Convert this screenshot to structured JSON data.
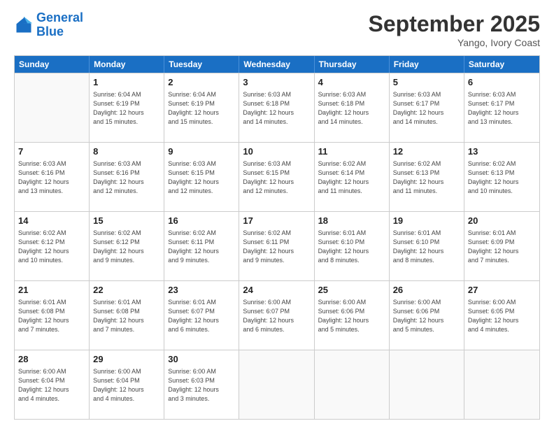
{
  "logo": {
    "line1": "General",
    "line2": "Blue"
  },
  "title": "September 2025",
  "subtitle": "Yango, Ivory Coast",
  "header_days": [
    "Sunday",
    "Monday",
    "Tuesday",
    "Wednesday",
    "Thursday",
    "Friday",
    "Saturday"
  ],
  "rows": [
    [
      {
        "day": "",
        "lines": []
      },
      {
        "day": "1",
        "lines": [
          "Sunrise: 6:04 AM",
          "Sunset: 6:19 PM",
          "Daylight: 12 hours",
          "and 15 minutes."
        ]
      },
      {
        "day": "2",
        "lines": [
          "Sunrise: 6:04 AM",
          "Sunset: 6:19 PM",
          "Daylight: 12 hours",
          "and 15 minutes."
        ]
      },
      {
        "day": "3",
        "lines": [
          "Sunrise: 6:03 AM",
          "Sunset: 6:18 PM",
          "Daylight: 12 hours",
          "and 14 minutes."
        ]
      },
      {
        "day": "4",
        "lines": [
          "Sunrise: 6:03 AM",
          "Sunset: 6:18 PM",
          "Daylight: 12 hours",
          "and 14 minutes."
        ]
      },
      {
        "day": "5",
        "lines": [
          "Sunrise: 6:03 AM",
          "Sunset: 6:17 PM",
          "Daylight: 12 hours",
          "and 14 minutes."
        ]
      },
      {
        "day": "6",
        "lines": [
          "Sunrise: 6:03 AM",
          "Sunset: 6:17 PM",
          "Daylight: 12 hours",
          "and 13 minutes."
        ]
      }
    ],
    [
      {
        "day": "7",
        "lines": [
          "Sunrise: 6:03 AM",
          "Sunset: 6:16 PM",
          "Daylight: 12 hours",
          "and 13 minutes."
        ]
      },
      {
        "day": "8",
        "lines": [
          "Sunrise: 6:03 AM",
          "Sunset: 6:16 PM",
          "Daylight: 12 hours",
          "and 12 minutes."
        ]
      },
      {
        "day": "9",
        "lines": [
          "Sunrise: 6:03 AM",
          "Sunset: 6:15 PM",
          "Daylight: 12 hours",
          "and 12 minutes."
        ]
      },
      {
        "day": "10",
        "lines": [
          "Sunrise: 6:03 AM",
          "Sunset: 6:15 PM",
          "Daylight: 12 hours",
          "and 12 minutes."
        ]
      },
      {
        "day": "11",
        "lines": [
          "Sunrise: 6:02 AM",
          "Sunset: 6:14 PM",
          "Daylight: 12 hours",
          "and 11 minutes."
        ]
      },
      {
        "day": "12",
        "lines": [
          "Sunrise: 6:02 AM",
          "Sunset: 6:13 PM",
          "Daylight: 12 hours",
          "and 11 minutes."
        ]
      },
      {
        "day": "13",
        "lines": [
          "Sunrise: 6:02 AM",
          "Sunset: 6:13 PM",
          "Daylight: 12 hours",
          "and 10 minutes."
        ]
      }
    ],
    [
      {
        "day": "14",
        "lines": [
          "Sunrise: 6:02 AM",
          "Sunset: 6:12 PM",
          "Daylight: 12 hours",
          "and 10 minutes."
        ]
      },
      {
        "day": "15",
        "lines": [
          "Sunrise: 6:02 AM",
          "Sunset: 6:12 PM",
          "Daylight: 12 hours",
          "and 9 minutes."
        ]
      },
      {
        "day": "16",
        "lines": [
          "Sunrise: 6:02 AM",
          "Sunset: 6:11 PM",
          "Daylight: 12 hours",
          "and 9 minutes."
        ]
      },
      {
        "day": "17",
        "lines": [
          "Sunrise: 6:02 AM",
          "Sunset: 6:11 PM",
          "Daylight: 12 hours",
          "and 9 minutes."
        ]
      },
      {
        "day": "18",
        "lines": [
          "Sunrise: 6:01 AM",
          "Sunset: 6:10 PM",
          "Daylight: 12 hours",
          "and 8 minutes."
        ]
      },
      {
        "day": "19",
        "lines": [
          "Sunrise: 6:01 AM",
          "Sunset: 6:10 PM",
          "Daylight: 12 hours",
          "and 8 minutes."
        ]
      },
      {
        "day": "20",
        "lines": [
          "Sunrise: 6:01 AM",
          "Sunset: 6:09 PM",
          "Daylight: 12 hours",
          "and 7 minutes."
        ]
      }
    ],
    [
      {
        "day": "21",
        "lines": [
          "Sunrise: 6:01 AM",
          "Sunset: 6:08 PM",
          "Daylight: 12 hours",
          "and 7 minutes."
        ]
      },
      {
        "day": "22",
        "lines": [
          "Sunrise: 6:01 AM",
          "Sunset: 6:08 PM",
          "Daylight: 12 hours",
          "and 7 minutes."
        ]
      },
      {
        "day": "23",
        "lines": [
          "Sunrise: 6:01 AM",
          "Sunset: 6:07 PM",
          "Daylight: 12 hours",
          "and 6 minutes."
        ]
      },
      {
        "day": "24",
        "lines": [
          "Sunrise: 6:00 AM",
          "Sunset: 6:07 PM",
          "Daylight: 12 hours",
          "and 6 minutes."
        ]
      },
      {
        "day": "25",
        "lines": [
          "Sunrise: 6:00 AM",
          "Sunset: 6:06 PM",
          "Daylight: 12 hours",
          "and 5 minutes."
        ]
      },
      {
        "day": "26",
        "lines": [
          "Sunrise: 6:00 AM",
          "Sunset: 6:06 PM",
          "Daylight: 12 hours",
          "and 5 minutes."
        ]
      },
      {
        "day": "27",
        "lines": [
          "Sunrise: 6:00 AM",
          "Sunset: 6:05 PM",
          "Daylight: 12 hours",
          "and 4 minutes."
        ]
      }
    ],
    [
      {
        "day": "28",
        "lines": [
          "Sunrise: 6:00 AM",
          "Sunset: 6:04 PM",
          "Daylight: 12 hours",
          "and 4 minutes."
        ]
      },
      {
        "day": "29",
        "lines": [
          "Sunrise: 6:00 AM",
          "Sunset: 6:04 PM",
          "Daylight: 12 hours",
          "and 4 minutes."
        ]
      },
      {
        "day": "30",
        "lines": [
          "Sunrise: 6:00 AM",
          "Sunset: 6:03 PM",
          "Daylight: 12 hours",
          "and 3 minutes."
        ]
      },
      {
        "day": "",
        "lines": []
      },
      {
        "day": "",
        "lines": []
      },
      {
        "day": "",
        "lines": []
      },
      {
        "day": "",
        "lines": []
      }
    ]
  ]
}
